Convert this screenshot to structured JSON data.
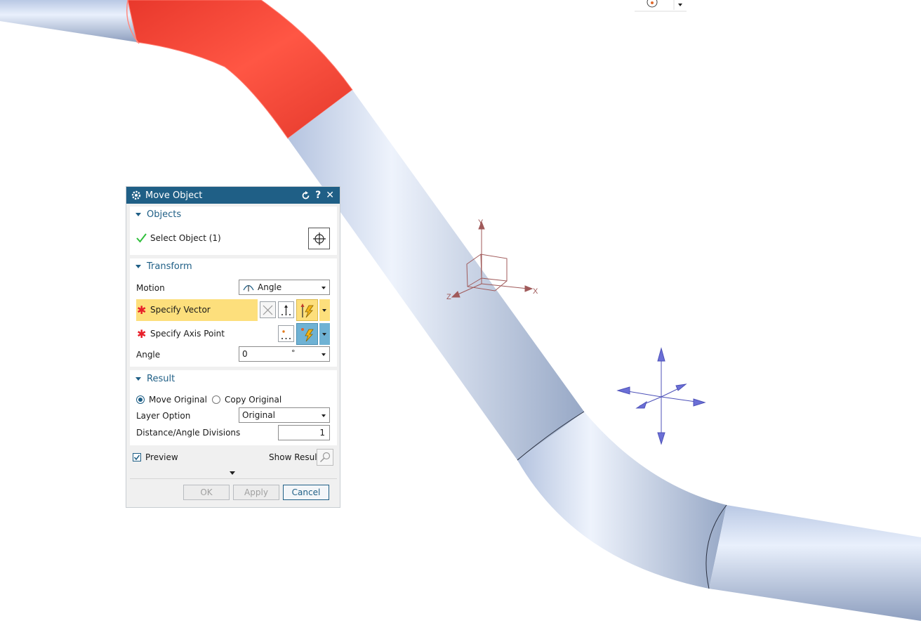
{
  "dialog": {
    "title": "Move Object",
    "sections": {
      "objects": {
        "header": "Objects",
        "select_object_label": "Select Object (1)"
      },
      "transform": {
        "header": "Transform",
        "motion_label": "Motion",
        "motion_value": "Angle",
        "specify_vector_label": "Specify Vector",
        "specify_axis_point_label": "Specify Axis Point",
        "angle_label": "Angle",
        "angle_value": "0",
        "angle_unit": "°"
      },
      "result": {
        "header": "Result",
        "move_original_label": "Move Original",
        "copy_original_label": "Copy Original",
        "selected_option": "Move Original",
        "layer_option_label": "Layer Option",
        "layer_option_value": "Original",
        "divisions_label": "Distance/Angle Divisions",
        "divisions_value": "1"
      }
    },
    "preview_label": "Preview",
    "preview_checked": true,
    "show_result_label": "Show Result",
    "buttons": {
      "ok": "OK",
      "apply": "Apply",
      "cancel": "Cancel"
    }
  },
  "viewport": {
    "axis_labels": {
      "x": "X",
      "y": "Y",
      "z": "Z"
    }
  },
  "colors": {
    "titlebar": "#1f5f86",
    "accent": "#1f5f86",
    "pipe": "#b7c8e4",
    "highlight": "#ff4f3f",
    "required_field": "#fddf7c",
    "required_star": "#e8202a"
  }
}
